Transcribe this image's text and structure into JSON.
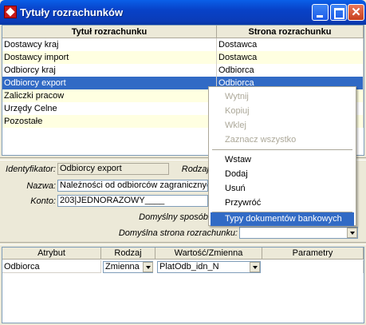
{
  "window": {
    "title": "Tytuły rozrachunków"
  },
  "table": {
    "headers": [
      "Tytuł rozrachunku",
      "Strona rozrachunku"
    ],
    "rows": [
      [
        "Dostawcy kraj",
        "Dostawca"
      ],
      [
        "Dostawcy import",
        "Dostawca"
      ],
      [
        "Odbiorcy kraj",
        "Odbiorca"
      ],
      [
        "Odbiorcy export",
        "Odbiorca"
      ],
      [
        "Zaliczki pracow",
        ""
      ],
      [
        "Urzędy Celne",
        ""
      ],
      [
        "Pozostałe",
        ""
      ]
    ],
    "selected_index": 3
  },
  "form": {
    "identifier_label": "Identyfikator:",
    "identifier_value": "Odbiorcy export",
    "rodzaj_label": "Rodzaj",
    "name_label": "Nazwa:",
    "name_value": "Należności od odbiorców zagranicznyc",
    "account_label": "Konto:",
    "account_value": "203|JEDNORAZOWY____",
    "default_method_label": "Domyślny sposób",
    "default_side_label": "Domyślna strona rozrachunku:",
    "default_side_value": ""
  },
  "attr_table": {
    "headers": [
      "Atrybut",
      "Rodzaj",
      "Wartość/Zmienna",
      "Parametry"
    ],
    "rows": [
      {
        "atrybut": "Odbiorca",
        "rodzaj": "Zmienna",
        "wartosc": "PlatOdb_idn_N",
        "parametry": ""
      }
    ]
  },
  "context_menu": {
    "items": [
      {
        "label": "Wytnij",
        "enabled": false
      },
      {
        "label": "Kopiuj",
        "enabled": false
      },
      {
        "label": "Wklej",
        "enabled": false
      },
      {
        "label": "Zaznacz wszystko",
        "enabled": false
      },
      {
        "label": "Wstaw",
        "enabled": true
      },
      {
        "label": "Dodaj",
        "enabled": true
      },
      {
        "label": "Usuń",
        "enabled": true
      },
      {
        "label": "Przywróć",
        "enabled": true
      },
      {
        "label": "Typy dokumentów bankowych",
        "enabled": true,
        "highlighted": true
      }
    ]
  }
}
